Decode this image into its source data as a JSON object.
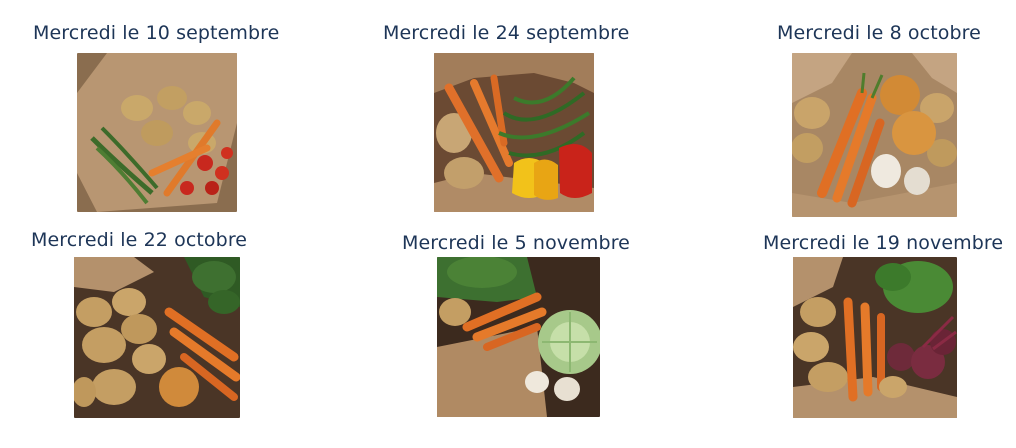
{
  "deliveries": [
    {
      "date": "Mercredi le 10 septembre",
      "image": "potatoes-green-beans-carrots-tomatoes-basket"
    },
    {
      "date": "Mercredi le 24 septembre",
      "image": "carrots-green-beans-potatoes-bell-peppers-basket"
    },
    {
      "date": "Mercredi le 8 octobre",
      "image": "carrots-onions-potatoes-garlic-basket"
    },
    {
      "date": "Mercredi le 22 octobre",
      "image": "potatoes-carrots-onion-spinach-basket"
    },
    {
      "date": "Mercredi le 5 novembre",
      "image": "carrots-potatoes-cabbage-turnips-basket"
    },
    {
      "date": "Mercredi le 19 novembre",
      "image": "potatoes-carrots-beets-greens-basket"
    }
  ]
}
